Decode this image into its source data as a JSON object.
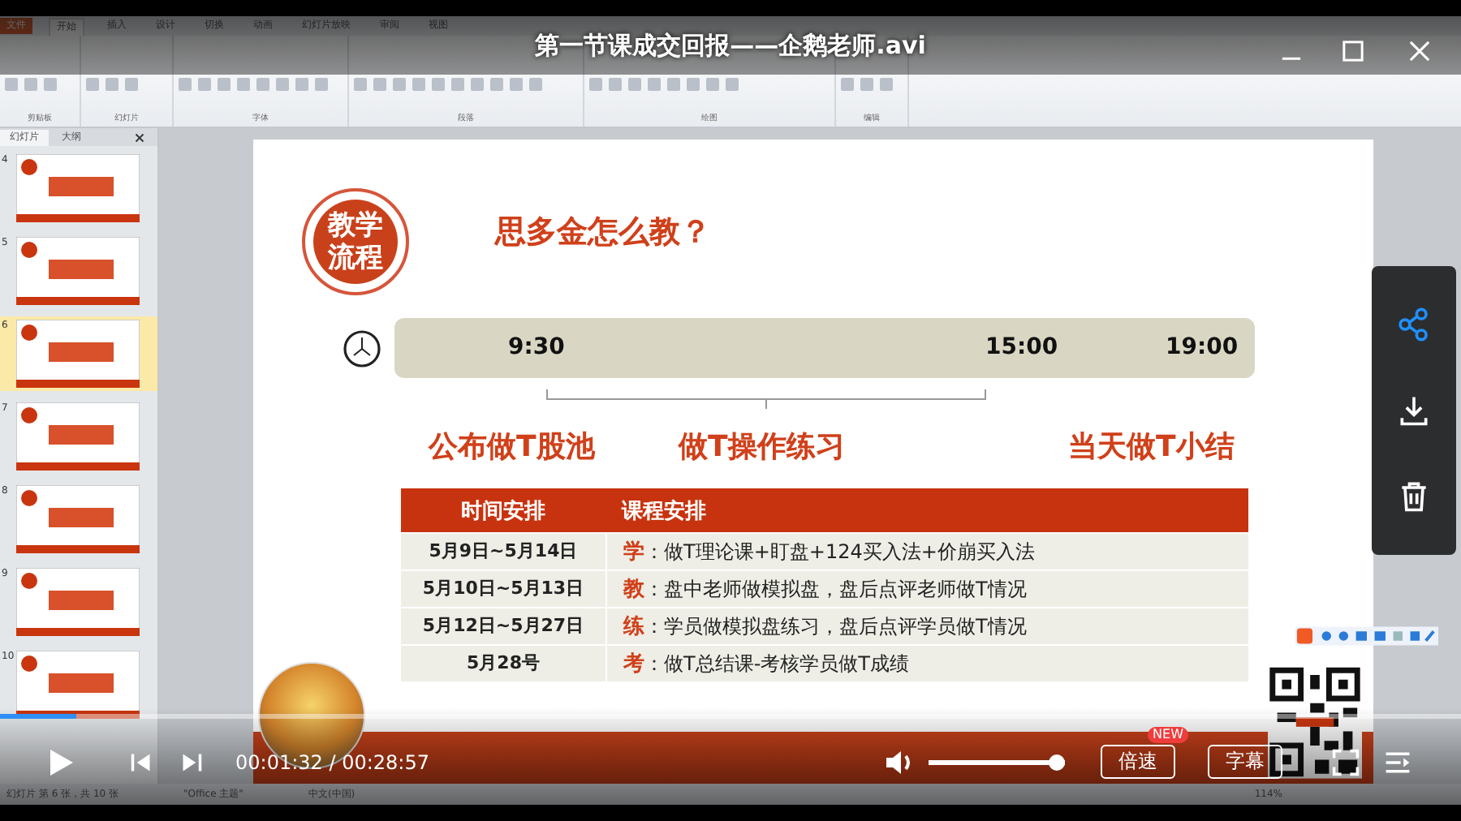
{
  "player": {
    "title": "第一节课成交回报——企鹅老师.avi",
    "progress": {
      "level": 0.052
    },
    "time": "00:01:32 / 00:28:57",
    "volume": {
      "level": 1
    },
    "buttons": [
      {
        "label": "倍速",
        "badge": "NEW"
      },
      {
        "label": "字幕"
      }
    ]
  },
  "ppt": {
    "ribbon_tabs": [
      {
        "label": "文件",
        "kind": "file",
        "selected": false
      },
      {
        "label": "开始",
        "kind": "tab",
        "selected": true
      },
      {
        "label": "插入",
        "kind": "tab",
        "selected": false
      },
      {
        "label": "设计",
        "kind": "tab",
        "selected": false
      },
      {
        "label": "切换",
        "kind": "tab",
        "selected": false
      },
      {
        "label": "动画",
        "kind": "tab",
        "selected": false
      },
      {
        "label": "幻灯片放映",
        "kind": "tab",
        "selected": false
      },
      {
        "label": "审阅",
        "kind": "tab",
        "selected": false
      },
      {
        "label": "视图",
        "kind": "tab",
        "selected": false
      }
    ],
    "ribbon_groups": [
      "剪贴板",
      "幻灯片",
      "字体",
      "段落",
      "绘图",
      "编辑"
    ],
    "panel_tabs": [
      {
        "label": "幻灯片",
        "selected": true
      },
      {
        "label": "大纲",
        "selected": false
      }
    ],
    "thumbnails": [
      {
        "number": "4",
        "selected": false
      },
      {
        "number": "5",
        "selected": false
      },
      {
        "number": "6",
        "selected": true
      },
      {
        "number": "7",
        "selected": false
      },
      {
        "number": "8",
        "selected": false
      },
      {
        "number": "9",
        "selected": false
      },
      {
        "number": "10",
        "selected": false
      }
    ],
    "status": [
      "幻灯片 第 6 张，共 10 张",
      "\"Office 主题\"",
      "中文(中国)",
      "114%"
    ]
  },
  "slide": {
    "badge": "教学流程",
    "title": "思多金怎么教？",
    "times": [
      "9:30",
      "15:00",
      "19:00"
    ],
    "phases": [
      "公布做T股池",
      "做T操作练习",
      "当天做T小结"
    ],
    "table": {
      "columns": [
        "时间安排",
        "课程安排"
      ],
      "rows": [
        {
          "date": "5月9日~5月14日",
          "key": "学",
          "text": "：做T理论课+盯盘+124买入法+价崩买入法"
        },
        {
          "date": "5月10日~5月13日",
          "key": "教",
          "text": "：盘中老师做模拟盘，盘后点评老师做T情况"
        },
        {
          "date": "5月12日~5月27日",
          "key": "练",
          "text": "：学员做模拟盘练习，盘后点评学员做T情况"
        },
        {
          "date": "5月28号",
          "key": "考",
          "text": "：做T总结课-考核学员做T成绩"
        }
      ]
    }
  }
}
